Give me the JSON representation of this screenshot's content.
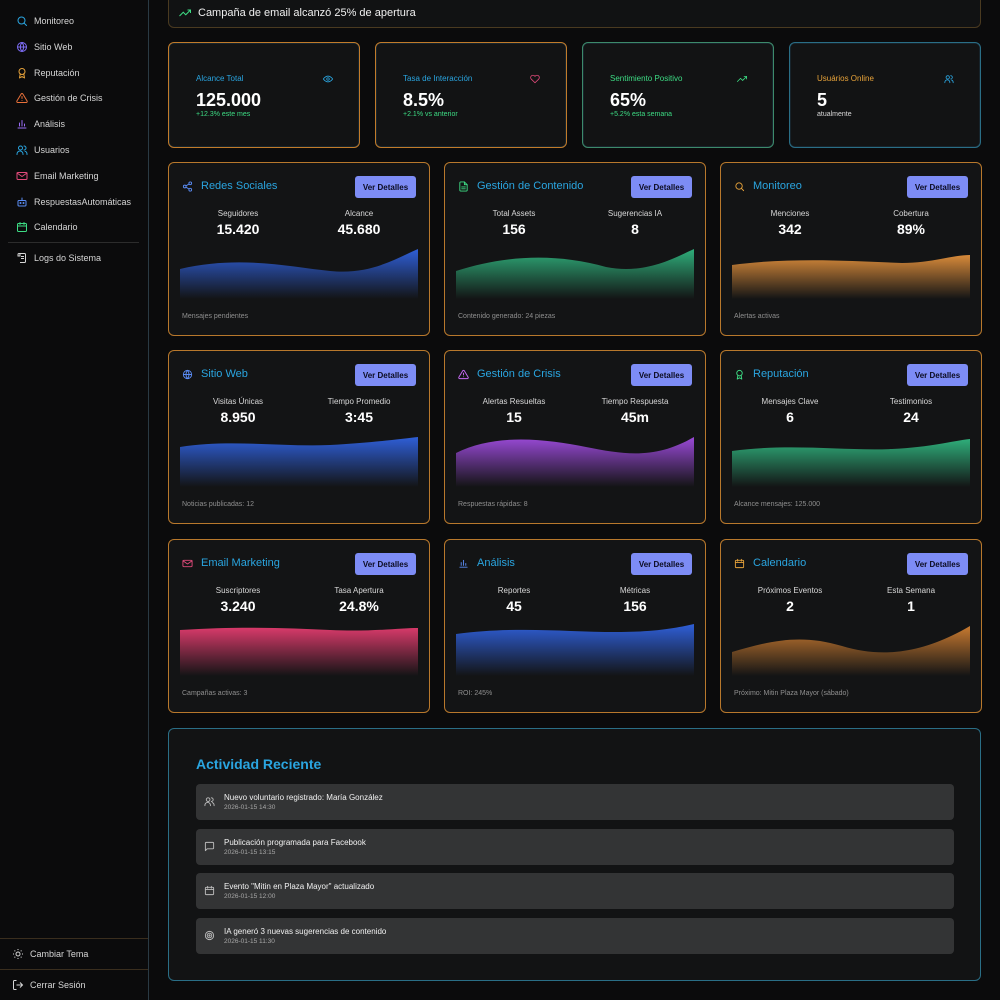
{
  "sidebar": {
    "items": [
      {
        "label": "Monitoreo",
        "icon": "search-icon",
        "color": "#2aa5e0"
      },
      {
        "label": "Sitio Web",
        "icon": "globe-icon",
        "color": "#7d6cf5"
      },
      {
        "label": "Reputación",
        "icon": "award-icon",
        "color": "#e8a33a"
      },
      {
        "label": "Gestión de Crisis",
        "icon": "alert-triangle-icon",
        "color": "#e8703a"
      },
      {
        "label": "Análisis",
        "icon": "bar-chart-icon",
        "color": "#9a6cf5"
      },
      {
        "label": "Usuarios",
        "icon": "users-icon",
        "color": "#2aa5e0"
      },
      {
        "label": "Email Marketing",
        "icon": "mail-icon",
        "color": "#e04a7a"
      },
      {
        "label": "RespuestasAutomáticas",
        "icon": "bot-icon",
        "color": "#5a8cf5"
      },
      {
        "label": "Calendario",
        "icon": "calendar-icon",
        "color": "#3ddc84"
      }
    ],
    "logs_label": "Logs do Sistema",
    "theme_label": "Cambiar Tema",
    "logout_label": "Cerrar Sesión"
  },
  "notice": {
    "text": "Campaña de email alcanzó 25% de apertura"
  },
  "stats": [
    {
      "label": "Alcance Total",
      "value": "125.000",
      "sub": "+12.3% este mes",
      "icon": "eye-icon",
      "color": "#2aa5e0",
      "sub_color": "#3ddc84"
    },
    {
      "label": "Tasa de Interacción",
      "value": "8.5%",
      "sub": "+2.1% vs anterior",
      "icon": "heart-icon",
      "color": "#2aa5e0",
      "sub_color": "#3ddc84"
    },
    {
      "label": "Sentimiento Positivo",
      "value": "65%",
      "sub": "+5.2% esta semana",
      "icon": "trending-up-icon",
      "color": "#3ddc84",
      "sub_color": "#3ddc84"
    },
    {
      "label": "Usuários Online",
      "value": "5",
      "sub": "atualmente",
      "icon": "users-icon",
      "color": "#e8a33a",
      "sub_color": "#d8d8d8"
    }
  ],
  "button_label": "Ver Detalles",
  "cards": [
    {
      "title": "Redes Sociales",
      "icon": "share-icon",
      "color": "#2aa5e0",
      "wave": "#2f5fd8",
      "m1_label": "Seguidores",
      "m1_value": "15.420",
      "m2_label": "Alcance",
      "m2_value": "45.680",
      "footer": "Mensajes pendientes"
    },
    {
      "title": "Gestión de Contenido",
      "icon": "file-text-icon",
      "color": "#2aa5e0",
      "wave": "#2fae7a",
      "m1_label": "Total Assets",
      "m1_value": "156",
      "m2_label": "Sugerencias IA",
      "m2_value": "8",
      "footer": "Contenido generado: 24 piezas"
    },
    {
      "title": "Monitoreo",
      "icon": "search-icon",
      "color": "#2aa5e0",
      "wave": "#d88a3a",
      "m1_label": "Menciones",
      "m1_value": "342",
      "m2_label": "Cobertura",
      "m2_value": "89%",
      "footer": "Alertas activas"
    },
    {
      "title": "Sitio Web",
      "icon": "globe-icon",
      "color": "#2aa5e0",
      "wave": "#2f5fd8",
      "m1_label": "Visitas Únicas",
      "m1_value": "8.950",
      "m2_label": "Tiempo Promedio",
      "m2_value": "3:45",
      "footer": "Noticias publicadas: 12"
    },
    {
      "title": "Gestión de Crisis",
      "icon": "alert-triangle-icon",
      "color": "#2aa5e0",
      "wave": "#9a4ad8",
      "m1_label": "Alertas Resueltas",
      "m1_value": "15",
      "m2_label": "Tiempo Respuesta",
      "m2_value": "45m",
      "footer": "Respuestas rápidas: 8"
    },
    {
      "title": "Reputación",
      "icon": "award-icon",
      "color": "#2aa5e0",
      "wave": "#2fae7a",
      "m1_label": "Mensajes Clave",
      "m1_value": "6",
      "m2_label": "Testimonios",
      "m2_value": "24",
      "footer": "Alcance mensajes: 125.000"
    },
    {
      "title": "Email Marketing",
      "icon": "mail-icon",
      "color": "#2aa5e0",
      "wave": "#d83a6a",
      "m1_label": "Suscriptores",
      "m1_value": "3.240",
      "m2_label": "Tasa Apertura",
      "m2_value": "24.8%",
      "footer": "Campañas activas: 3"
    },
    {
      "title": "Análisis",
      "icon": "bar-chart-icon",
      "color": "#2aa5e0",
      "wave": "#2f5fd8",
      "m1_label": "Reportes",
      "m1_value": "45",
      "m2_label": "Métricas",
      "m2_value": "156",
      "footer": "ROI: 245%"
    },
    {
      "title": "Calendario",
      "icon": "calendar-icon",
      "color": "#2aa5e0",
      "wave": "#c87a30",
      "m1_label": "Próximos Eventos",
      "m1_value": "2",
      "m2_label": "Esta Semana",
      "m2_value": "1",
      "footer": "Próximo: Mitin Plaza Mayor (sábado)"
    }
  ],
  "activity": {
    "title": "Actividad Reciente",
    "items": [
      {
        "text": "Nuevo voluntario registrado: María González",
        "date": "2026-01-15 14:30",
        "icon": "users-icon"
      },
      {
        "text": "Publicación programada para Facebook",
        "date": "2026-01-15 13:15",
        "icon": "message-icon"
      },
      {
        "text": "Evento \"Mitin en Plaza Mayor\" actualizado",
        "date": "2026-01-15 12:00",
        "icon": "calendar-icon"
      },
      {
        "text": "IA generó 3 nuevas sugerencias de contenido",
        "date": "2026-01-15 11:30",
        "icon": "target-icon"
      }
    ]
  }
}
